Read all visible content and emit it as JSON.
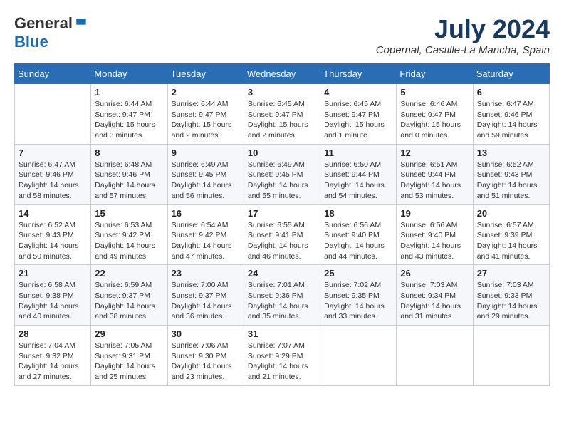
{
  "logo": {
    "general": "General",
    "blue": "Blue"
  },
  "title": {
    "month": "July 2024",
    "location": "Copernal, Castille-La Mancha, Spain"
  },
  "headers": [
    "Sunday",
    "Monday",
    "Tuesday",
    "Wednesday",
    "Thursday",
    "Friday",
    "Saturday"
  ],
  "weeks": [
    [
      {
        "day": "",
        "info": ""
      },
      {
        "day": "1",
        "info": "Sunrise: 6:44 AM\nSunset: 9:47 PM\nDaylight: 15 hours\nand 3 minutes."
      },
      {
        "day": "2",
        "info": "Sunrise: 6:44 AM\nSunset: 9:47 PM\nDaylight: 15 hours\nand 2 minutes."
      },
      {
        "day": "3",
        "info": "Sunrise: 6:45 AM\nSunset: 9:47 PM\nDaylight: 15 hours\nand 2 minutes."
      },
      {
        "day": "4",
        "info": "Sunrise: 6:45 AM\nSunset: 9:47 PM\nDaylight: 15 hours\nand 1 minute."
      },
      {
        "day": "5",
        "info": "Sunrise: 6:46 AM\nSunset: 9:47 PM\nDaylight: 15 hours\nand 0 minutes."
      },
      {
        "day": "6",
        "info": "Sunrise: 6:47 AM\nSunset: 9:46 PM\nDaylight: 14 hours\nand 59 minutes."
      }
    ],
    [
      {
        "day": "7",
        "info": "Sunrise: 6:47 AM\nSunset: 9:46 PM\nDaylight: 14 hours\nand 58 minutes."
      },
      {
        "day": "8",
        "info": "Sunrise: 6:48 AM\nSunset: 9:46 PM\nDaylight: 14 hours\nand 57 minutes."
      },
      {
        "day": "9",
        "info": "Sunrise: 6:49 AM\nSunset: 9:45 PM\nDaylight: 14 hours\nand 56 minutes."
      },
      {
        "day": "10",
        "info": "Sunrise: 6:49 AM\nSunset: 9:45 PM\nDaylight: 14 hours\nand 55 minutes."
      },
      {
        "day": "11",
        "info": "Sunrise: 6:50 AM\nSunset: 9:44 PM\nDaylight: 14 hours\nand 54 minutes."
      },
      {
        "day": "12",
        "info": "Sunrise: 6:51 AM\nSunset: 9:44 PM\nDaylight: 14 hours\nand 53 minutes."
      },
      {
        "day": "13",
        "info": "Sunrise: 6:52 AM\nSunset: 9:43 PM\nDaylight: 14 hours\nand 51 minutes."
      }
    ],
    [
      {
        "day": "14",
        "info": "Sunrise: 6:52 AM\nSunset: 9:43 PM\nDaylight: 14 hours\nand 50 minutes."
      },
      {
        "day": "15",
        "info": "Sunrise: 6:53 AM\nSunset: 9:42 PM\nDaylight: 14 hours\nand 49 minutes."
      },
      {
        "day": "16",
        "info": "Sunrise: 6:54 AM\nSunset: 9:42 PM\nDaylight: 14 hours\nand 47 minutes."
      },
      {
        "day": "17",
        "info": "Sunrise: 6:55 AM\nSunset: 9:41 PM\nDaylight: 14 hours\nand 46 minutes."
      },
      {
        "day": "18",
        "info": "Sunrise: 6:56 AM\nSunset: 9:40 PM\nDaylight: 14 hours\nand 44 minutes."
      },
      {
        "day": "19",
        "info": "Sunrise: 6:56 AM\nSunset: 9:40 PM\nDaylight: 14 hours\nand 43 minutes."
      },
      {
        "day": "20",
        "info": "Sunrise: 6:57 AM\nSunset: 9:39 PM\nDaylight: 14 hours\nand 41 minutes."
      }
    ],
    [
      {
        "day": "21",
        "info": "Sunrise: 6:58 AM\nSunset: 9:38 PM\nDaylight: 14 hours\nand 40 minutes."
      },
      {
        "day": "22",
        "info": "Sunrise: 6:59 AM\nSunset: 9:37 PM\nDaylight: 14 hours\nand 38 minutes."
      },
      {
        "day": "23",
        "info": "Sunrise: 7:00 AM\nSunset: 9:37 PM\nDaylight: 14 hours\nand 36 minutes."
      },
      {
        "day": "24",
        "info": "Sunrise: 7:01 AM\nSunset: 9:36 PM\nDaylight: 14 hours\nand 35 minutes."
      },
      {
        "day": "25",
        "info": "Sunrise: 7:02 AM\nSunset: 9:35 PM\nDaylight: 14 hours\nand 33 minutes."
      },
      {
        "day": "26",
        "info": "Sunrise: 7:03 AM\nSunset: 9:34 PM\nDaylight: 14 hours\nand 31 minutes."
      },
      {
        "day": "27",
        "info": "Sunrise: 7:03 AM\nSunset: 9:33 PM\nDaylight: 14 hours\nand 29 minutes."
      }
    ],
    [
      {
        "day": "28",
        "info": "Sunrise: 7:04 AM\nSunset: 9:32 PM\nDaylight: 14 hours\nand 27 minutes."
      },
      {
        "day": "29",
        "info": "Sunrise: 7:05 AM\nSunset: 9:31 PM\nDaylight: 14 hours\nand 25 minutes."
      },
      {
        "day": "30",
        "info": "Sunrise: 7:06 AM\nSunset: 9:30 PM\nDaylight: 14 hours\nand 23 minutes."
      },
      {
        "day": "31",
        "info": "Sunrise: 7:07 AM\nSunset: 9:29 PM\nDaylight: 14 hours\nand 21 minutes."
      },
      {
        "day": "",
        "info": ""
      },
      {
        "day": "",
        "info": ""
      },
      {
        "day": "",
        "info": ""
      }
    ]
  ]
}
